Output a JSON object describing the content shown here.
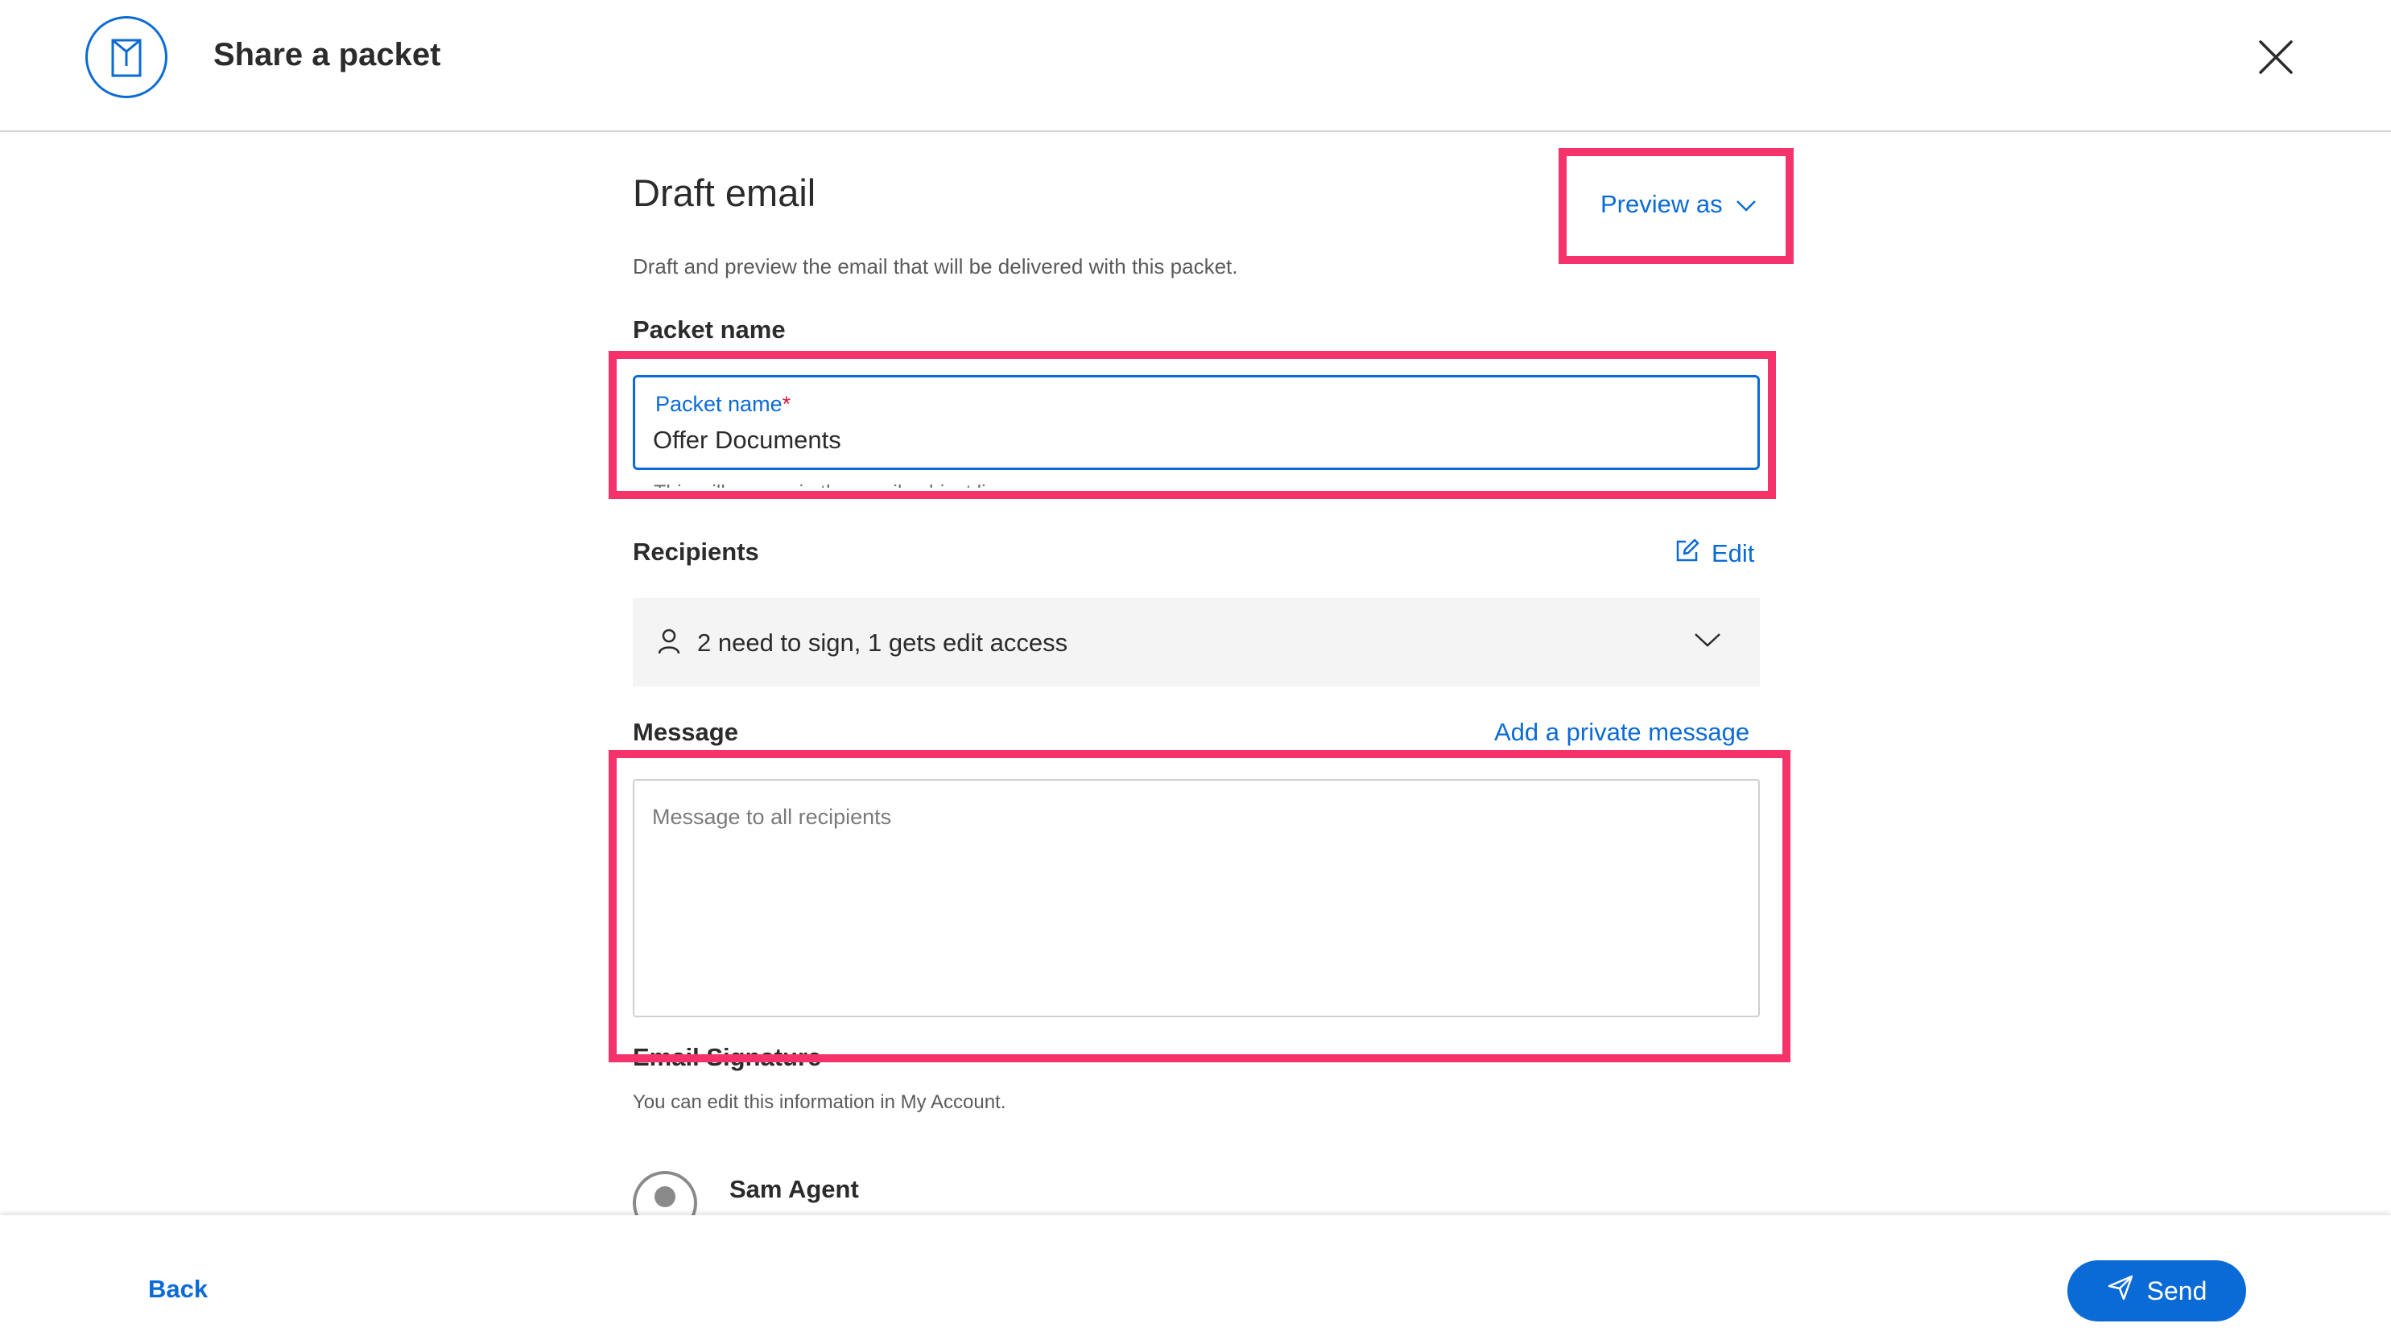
{
  "header": {
    "title": "Share a packet",
    "logo_icon": "packet-icon",
    "close_icon": "close-icon"
  },
  "draft": {
    "title": "Draft email",
    "preview_label": "Preview as",
    "subtitle": "Draft and preview the email that will be delivered with this packet."
  },
  "packet": {
    "section_label": "Packet name",
    "field_label": "Packet name",
    "required_mark": "*",
    "value": "Offer Documents",
    "helper": "This will appear in the email subject line"
  },
  "recipients": {
    "section_label": "Recipients",
    "edit_label": "Edit",
    "summary": "2 need to sign, 1 gets edit access"
  },
  "message": {
    "section_label": "Message",
    "private_link": "Add a private message",
    "placeholder": "Message to all recipients"
  },
  "signature": {
    "section_label": "Email Signature",
    "note": "You can edit this information in My Account.",
    "name": "Sam Agent"
  },
  "footer": {
    "back_label": "Back",
    "send_label": "Send"
  },
  "colors": {
    "accent": "#0b6bd6",
    "highlight": "#f5336a",
    "required": "#d6193b"
  }
}
